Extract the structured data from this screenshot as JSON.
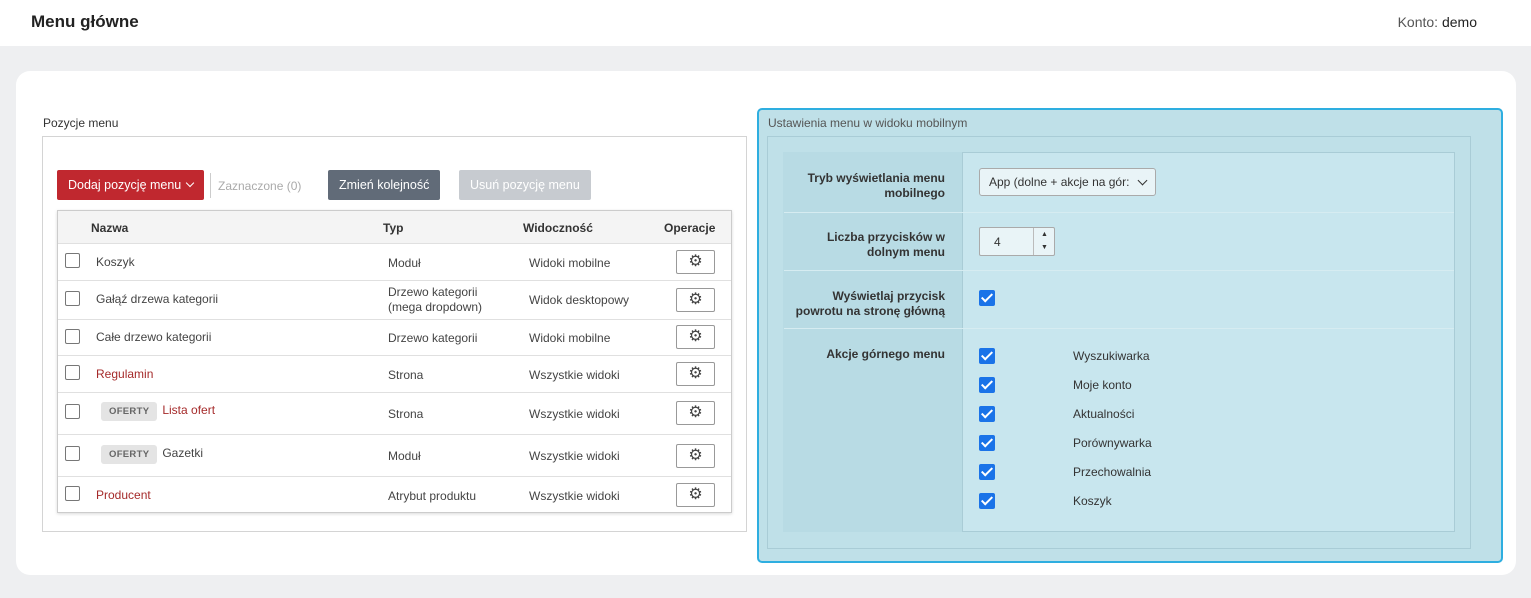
{
  "header": {
    "title": "Menu główne",
    "account_label": "Konto:",
    "account_value": "demo"
  },
  "left": {
    "legend": "Pozycje menu",
    "add_button": "Dodaj pozycję menu",
    "selected_label": "Zaznaczone (0)",
    "order_button": "Zmień kolejność",
    "delete_button": "Usuń pozycję menu",
    "columns": [
      "Nazwa",
      "Typ",
      "Widoczność",
      "Operacje"
    ],
    "rows": [
      {
        "tag": "",
        "name": "Koszyk",
        "type": "Moduł",
        "visibility": "Widoki mobilne"
      },
      {
        "tag": "",
        "name": "Gałąź drzewa kategorii",
        "type": "Drzewo kategorii (mega dropdown)",
        "visibility": "Widok desktopowy"
      },
      {
        "tag": "",
        "name": "Całe drzewo kategorii",
        "type": "Drzewo kategorii",
        "visibility": "Widoki mobilne"
      },
      {
        "tag": "",
        "name": "Regulamin",
        "type": "Strona",
        "visibility": "Wszystkie widoki"
      },
      {
        "tag": "OFERTY",
        "name": "Lista ofert",
        "type": "Strona",
        "visibility": "Wszystkie widoki"
      },
      {
        "tag": "OFERTY",
        "name": "Gazetki",
        "type": "Moduł",
        "visibility": "Wszystkie widoki"
      },
      {
        "tag": "",
        "name": "Producent",
        "type": "Atrybut produktu",
        "visibility": "Wszystkie widoki"
      }
    ],
    "colors": {
      "red_link": "#a52a2a",
      "add_button": "#c0282f"
    }
  },
  "right": {
    "legend": "Ustawienia menu w widoku mobilnym",
    "display_mode_label": "Tryb wyświetlania menu mobilnego",
    "display_mode_value": "App (dolne + akcje na gór:",
    "buttons_count_label": "Liczba przycisków w dolnym menu",
    "buttons_count_value": "4",
    "back_button_label": "Wyświetlaj przycisk powrotu na stronę główną",
    "back_button_checked": true,
    "top_actions_label": "Akcje górnego menu",
    "top_actions": [
      "Wyszukiwarka",
      "Moje konto",
      "Aktualności",
      "Porównywarka",
      "Przechowalnia",
      "Koszyk"
    ],
    "colors": {
      "panel": "#bfe0e8",
      "border": "#2eaee0",
      "checkbox": "#1a73e8"
    }
  }
}
